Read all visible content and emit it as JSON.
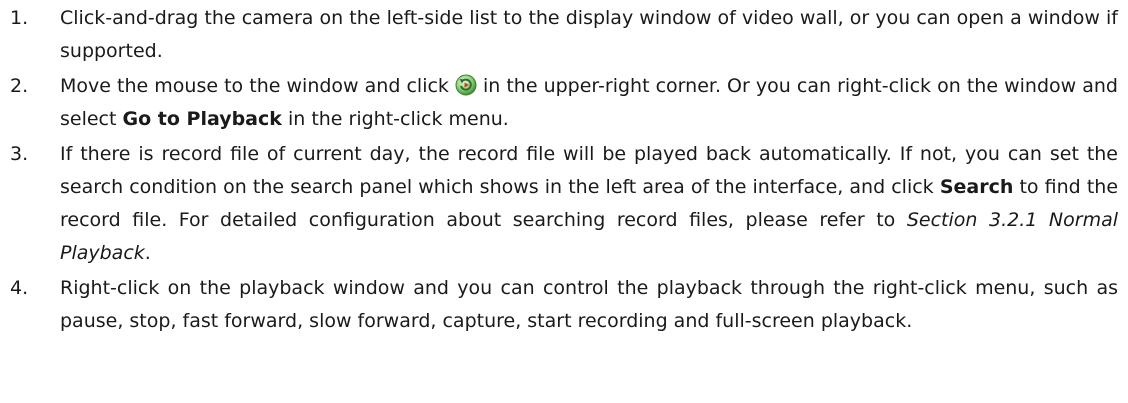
{
  "steps": [
    {
      "number": "1.",
      "text": "Click-and-drag the camera on the left-side list to the display window of video wall, or you can open a window if supported."
    },
    {
      "number": "2.",
      "text_before_icon": "Move the mouse to the window and click",
      "icon": "playback-icon",
      "text_after_icon": "in the upper-right corner. Or you can right-click on the window and select",
      "bold": "Go to Playback",
      "text_end": "in the right-click menu."
    },
    {
      "number": "3.",
      "text_1": "If there is record file of current day, the record file will be played back automatically. If not, you can set the search condition on the search panel which shows in the left area of the interface, and click",
      "bold": "Search",
      "text_2": "to find the record file. For detailed configuration about searching record files, please refer to",
      "italic": "Section 3.2.1 Normal Playback",
      "text_end": "."
    },
    {
      "number": "4.",
      "text": "Right-click on the playback window and you can control the playback through the right-click menu, such as pause, stop, fast forward, slow forward, capture, start recording and full-screen playback."
    }
  ]
}
